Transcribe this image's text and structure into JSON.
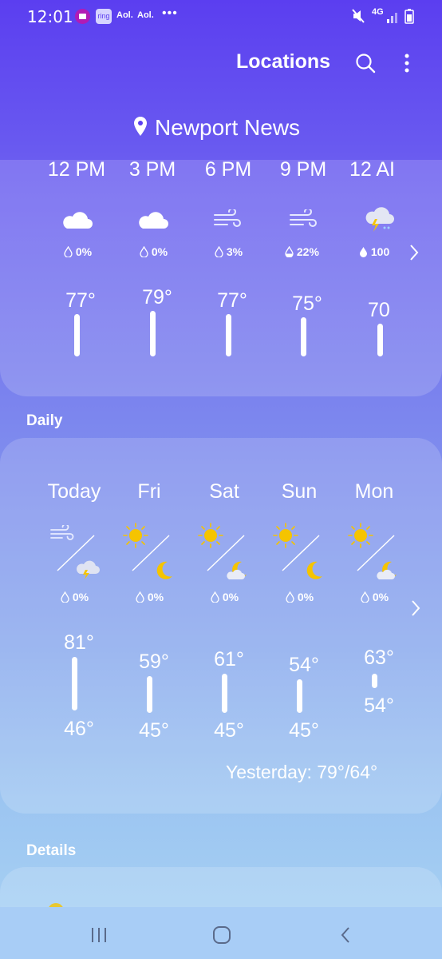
{
  "status_bar": {
    "time": "12:01",
    "notif_ring": "ring",
    "notif_aol1": "Aol.",
    "notif_aol2": "Aol.",
    "more": "•••",
    "network": "4G"
  },
  "header": {
    "title": "Locations",
    "location": "Newport News"
  },
  "hourly": [
    {
      "time": "12 PM",
      "icon": "cloud-icon",
      "precip": "0%",
      "temp": "77°"
    },
    {
      "time": "3 PM",
      "icon": "cloud-icon",
      "precip": "0%",
      "temp": "79°"
    },
    {
      "time": "6 PM",
      "icon": "wind-icon",
      "precip": "3%",
      "temp": "77°"
    },
    {
      "time": "9 PM",
      "icon": "wind-icon",
      "precip": "22%",
      "temp": "75°"
    },
    {
      "time": "12 AI",
      "icon": "thunderstorm-icon",
      "precip": "100",
      "temp": "70"
    }
  ],
  "daily_title": "Daily",
  "daily": [
    {
      "day": "Today",
      "precip": "0%",
      "high": "81°",
      "low": "46°",
      "day_icon": "wind-icon",
      "night_icon": "thunderstorm-icon"
    },
    {
      "day": "Fri",
      "precip": "0%",
      "high": "59°",
      "low": "45°",
      "day_icon": "sun-icon",
      "night_icon": "moon-icon"
    },
    {
      "day": "Sat",
      "precip": "0%",
      "high": "61°",
      "low": "45°",
      "day_icon": "sun-icon",
      "night_icon": "moon-cloud-icon"
    },
    {
      "day": "Sun",
      "precip": "0%",
      "high": "54°",
      "low": "45°",
      "day_icon": "sun-icon",
      "night_icon": "moon-icon"
    },
    {
      "day": "Mon",
      "precip": "0%",
      "high": "63°",
      "low": "54°",
      "day_icon": "sun-icon",
      "night_icon": "moon-cloud-icon"
    }
  ],
  "yesterday": "Yesterday: 79°/64°",
  "details_title": "Details",
  "colors": {
    "accent": "#5b3ef0",
    "sun": "#f5c400",
    "moon": "#f5c400"
  }
}
